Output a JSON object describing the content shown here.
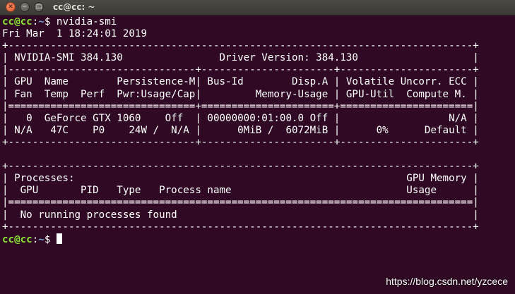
{
  "window": {
    "title": "cc@cc: ~",
    "close_glyph": "✕",
    "minimize_glyph": "−",
    "maximize_glyph": "□",
    "close_icon": "close-icon",
    "minimize_icon": "minimize-icon",
    "maximize_icon": "maximize-icon"
  },
  "prompt": {
    "user": "cc@cc",
    "sep": ":",
    "path": "~",
    "sym": "$ "
  },
  "command": "nvidia-smi",
  "timestamp": "Fri Mar  1 18:24:01 2019",
  "smi": {
    "border": "+-----------------------------------------------------------------------------+",
    "header": "| NVIDIA-SMI 384.130                Driver Version: 384.130                   |",
    "divider": "|-------------------------------+----------------------+----------------------+",
    "col_head_1": "| GPU  Name        Persistence-M| Bus-Id        Disp.A | Volatile Uncorr. ECC |",
    "col_head_2": "| Fan  Temp  Perf  Pwr:Usage/Cap|         Memory-Usage | GPU-Util  Compute M. |",
    "double_divider": "|===============================+======================+======================|",
    "gpu_row_1": "|   0  GeForce GTX 1060    Off  | 00000000:01:00.0 Off |                  N/A |",
    "gpu_row_2": "| N/A   47C    P0    24W /  N/A |      0MiB /  6072MiB |      0%      Default |",
    "table_bottom": "+-------------------------------+----------------------+----------------------+"
  },
  "processes": {
    "border": "+-----------------------------------------------------------------------------+",
    "header_1": "| Processes:                                                       GPU Memory |",
    "header_2": "|  GPU       PID   Type   Process name                             Usage      |",
    "divider": "|=============================================================================|",
    "message_row": "|  No running processes found                                                 |",
    "bottom": "+-----------------------------------------------------------------------------+"
  },
  "watermark": "https://blog.csdn.net/yzcece",
  "colors": {
    "background": "#300a24",
    "prompt_user": "#8ae234",
    "prompt_path": "#729fcf",
    "text": "#ffffff"
  }
}
